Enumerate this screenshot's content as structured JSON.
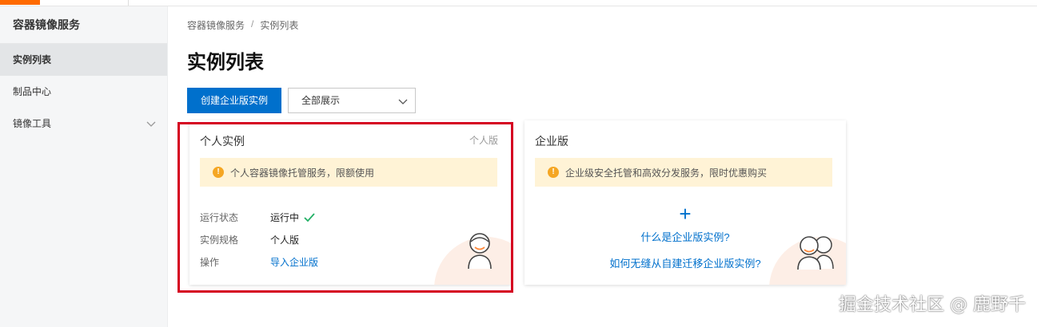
{
  "sidebar": {
    "title": "容器镜像服务",
    "items": [
      {
        "label": "实例列表"
      },
      {
        "label": "制品中心"
      },
      {
        "label": "镜像工具"
      }
    ]
  },
  "breadcrumb": {
    "items": [
      "容器镜像服务",
      "实例列表"
    ],
    "separator": "/"
  },
  "page": {
    "title": "实例列表"
  },
  "toolbar": {
    "create_label": "创建企业版实例",
    "filter_value": "全部展示"
  },
  "cards": {
    "personal": {
      "title": "个人实例",
      "tag": "个人版",
      "notice": "个人容器镜像托管服务，限额使用",
      "rows": [
        {
          "key": "运行状态",
          "value": "运行中"
        },
        {
          "key": "实例规格",
          "value": "个人版"
        },
        {
          "key": "操作",
          "value": "导入企业版"
        }
      ]
    },
    "enterprise": {
      "title": "企业版",
      "notice": "企业级安全托管和高效分发服务，限时优惠购买",
      "plus": "+",
      "link1": "什么是企业版实例?",
      "link2": "如何无缝从自建迁移企业版实例?"
    }
  },
  "watermark": "掘金技术社区 @ 鹿野千",
  "colors": {
    "primary": "#0070cc",
    "brand": "#ff6a00",
    "notice_bg": "#fff3d6",
    "warn": "#f5a623",
    "status_ok": "#23b066",
    "highlight": "#d50021"
  }
}
